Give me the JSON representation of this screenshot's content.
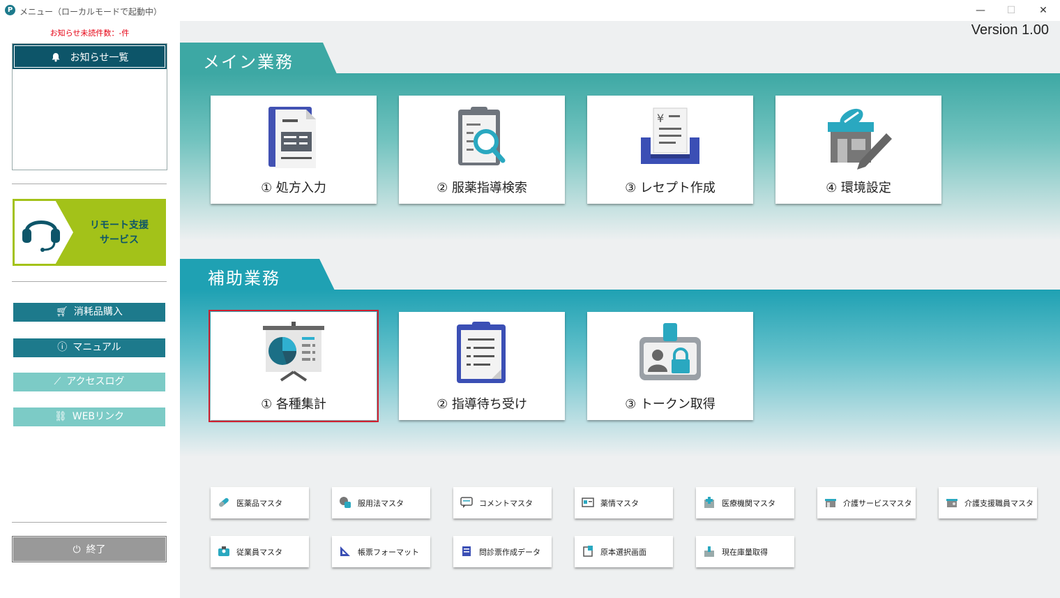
{
  "window": {
    "title": "メニュー（ローカルモードで起動中）",
    "app_icon": "P",
    "minimize": "—",
    "maximize": "☐",
    "close": "✕"
  },
  "sidebar": {
    "unread_notice": "お知らせ未読件数：-件",
    "notice_list_label": "お知らせ一覧",
    "remote_support_line1": "リモート支援",
    "remote_support_line2": "サービス",
    "buttons": [
      {
        "label": "消耗品購入",
        "icon": "cart-icon"
      },
      {
        "label": "マニュアル",
        "icon": "question-icon"
      },
      {
        "label": "アクセスログ",
        "icon": "chart-line-icon"
      },
      {
        "label": "WEBリンク",
        "icon": "link-icon"
      }
    ],
    "exit_label": "終了"
  },
  "main": {
    "version": "Version 1.00",
    "main_section_title": "メイン業務",
    "main_cards": [
      {
        "label": "① 処方入力",
        "icon": "prescription-document-icon"
      },
      {
        "label": "② 服薬指導検索",
        "icon": "clipboard-search-icon"
      },
      {
        "label": "③ レセプト作成",
        "icon": "receipt-tray-icon"
      },
      {
        "label": "④ 環境設定",
        "icon": "pharmacy-settings-icon"
      }
    ],
    "aux_section_title": "補助業務",
    "aux_cards": [
      {
        "label": "① 各種集計",
        "icon": "presentation-chart-icon"
      },
      {
        "label": "② 指導待ち受け",
        "icon": "clipboard-list-icon"
      },
      {
        "label": "③ トークン取得",
        "icon": "id-badge-lock-icon"
      }
    ],
    "masters": [
      {
        "label": "医薬品マスタ",
        "icon": "pill-icon"
      },
      {
        "label": "服用法マスタ",
        "icon": "dosage-icon"
      },
      {
        "label": "コメントマスタ",
        "icon": "comment-icon"
      },
      {
        "label": "薬情マスタ",
        "icon": "drug-info-icon"
      },
      {
        "label": "医療機関マスタ",
        "icon": "hospital-icon"
      },
      {
        "label": "介護サービスマスタ",
        "icon": "care-service-icon"
      },
      {
        "label": "介護支援職員マスタ",
        "icon": "care-staff-icon"
      },
      {
        "label": "従業員マスタ",
        "icon": "employee-icon"
      },
      {
        "label": "帳票フォーマット",
        "icon": "form-format-icon"
      },
      {
        "label": "問診票作成データ",
        "icon": "questionnaire-icon"
      },
      {
        "label": "原本選択画面",
        "icon": "original-select-icon"
      },
      {
        "label": "現在庫量取得",
        "icon": "inventory-icon"
      }
    ]
  },
  "colors": {
    "accent_dark": "#0d5569",
    "accent_teal": "#1d7a8c",
    "main_band": "#3da8a4",
    "aux_band": "#1fa1b3",
    "remote_green": "#a3c219",
    "selected_outline": "#d02030"
  }
}
